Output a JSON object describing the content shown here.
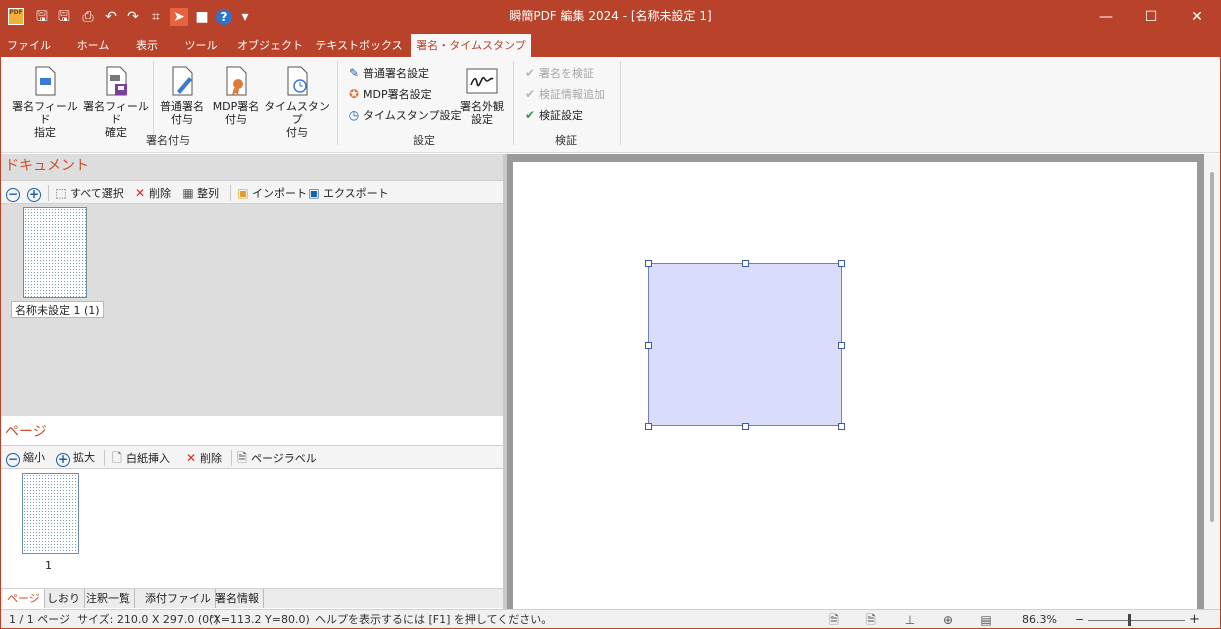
{
  "app": {
    "title": "瞬簡PDF 編集 2024 - [名称未設定 1]",
    "logo_text": "PDF"
  },
  "quick_access": [
    {
      "name": "save-icon",
      "glyph": "🖫"
    },
    {
      "name": "save-as-icon",
      "glyph": "🖫"
    },
    {
      "name": "print-icon",
      "glyph": "⎙"
    },
    {
      "name": "undo-icon",
      "glyph": "↶"
    },
    {
      "name": "redo-icon",
      "glyph": "↷"
    },
    {
      "name": "select-text-icon",
      "glyph": "⌗"
    },
    {
      "name": "pointer-icon",
      "glyph": "➤"
    },
    {
      "name": "rectangle-select-icon",
      "glyph": "■"
    },
    {
      "name": "help-icon",
      "glyph": "?"
    },
    {
      "name": "customize-qat-icon",
      "glyph": "▾"
    }
  ],
  "window_controls": {
    "minimize": "—",
    "maximize": "☐",
    "close": "✕"
  },
  "tabs": [
    "ファイル",
    "ホーム",
    "表示",
    "ツール",
    "オブジェクト",
    "テキストボックス",
    "署名・タイムスタンプ"
  ],
  "active_tab": "署名・タイムスタンプ",
  "ribbon": {
    "sign_group": {
      "label": "署名付与",
      "buttons": [
        {
          "label": "署名フィールド\n指定",
          "icon": "signature-field-icon"
        },
        {
          "label": "署名フィールド\n確定",
          "icon": "signature-field-confirm-icon"
        },
        {
          "label": "普通署名\n付与",
          "icon": "normal-signature-icon"
        },
        {
          "label": "MDP署名\n付与",
          "icon": "mdp-signature-icon"
        },
        {
          "label": "タイムスタンプ\n付与",
          "icon": "timestamp-icon"
        }
      ]
    },
    "settings_group": {
      "label": "設定",
      "small_buttons": [
        "普通署名設定",
        "MDP署名設定",
        "タイムスタンプ設定"
      ],
      "appearance_button": "署名外観\n設定"
    },
    "verify_group": {
      "label": "検証",
      "small_buttons": [
        {
          "label": "署名を検証",
          "enabled": false
        },
        {
          "label": "検証情報追加",
          "enabled": false
        },
        {
          "label": "検証設定",
          "enabled": true
        }
      ]
    }
  },
  "document_panel": {
    "title": "ドキュメント",
    "toolbar": [
      "すべて選択",
      "削除",
      "整列",
      "インポート",
      "エクスポート"
    ],
    "thumbnail_label": "名称未設定 1 (1)"
  },
  "page_panel": {
    "title": "ページ",
    "toolbar": [
      "縮小",
      "拡大",
      "白紙挿入",
      "削除",
      "ページラベル"
    ],
    "page_number": "1"
  },
  "bottom_tabs": [
    "ページ",
    "しおり",
    "注釈一覧",
    "添付ファイル",
    "署名情報"
  ],
  "status": {
    "page": "1 / 1 ページ",
    "size": "サイズ: 210.0 X 297.0 (0°)",
    "coords": "(X=113.2 Y=80.0)",
    "help": "ヘルプを表示するには [F1] を押してください。",
    "zoom": "86.3%",
    "zoom_minus": "−",
    "zoom_plus": "+"
  },
  "colors": {
    "accent": "#b8432a",
    "panel_title": "#d24b2c",
    "shape_fill": "#dadcfb",
    "shape_border": "#6e7fc7"
  }
}
